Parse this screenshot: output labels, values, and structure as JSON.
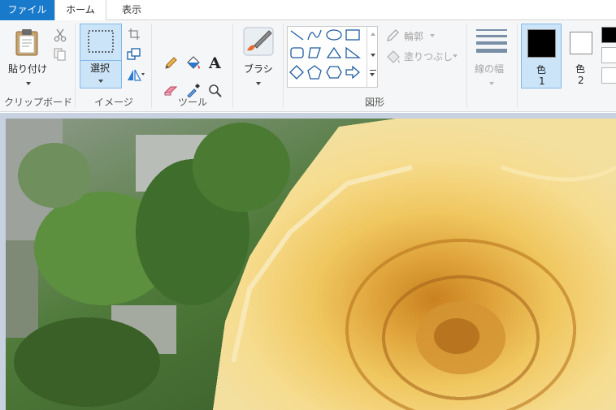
{
  "tabs": [
    {
      "label": "ファイル"
    },
    {
      "label": "ホーム"
    },
    {
      "label": "表示"
    }
  ],
  "clipboard": {
    "paste_label": "貼り付け",
    "group_label": "クリップボード"
  },
  "image": {
    "select_label": "選択",
    "group_label": "イメージ"
  },
  "tools": {
    "group_label": "ツール"
  },
  "brushes": {
    "label": "ブラシ"
  },
  "shapes": {
    "outline_label": "輪郭",
    "fill_label": "塗りつぶし",
    "group_label": "図形"
  },
  "size": {
    "label": "線の幅"
  },
  "colors": {
    "color1_label": "色",
    "color1_num": "1",
    "color2_label": "色",
    "color2_num": "2",
    "color1_value": "#000000",
    "color2_value": "#ffffff"
  },
  "theme": {
    "accent": "#1979ca",
    "selected_bg": "#cce4f7"
  }
}
